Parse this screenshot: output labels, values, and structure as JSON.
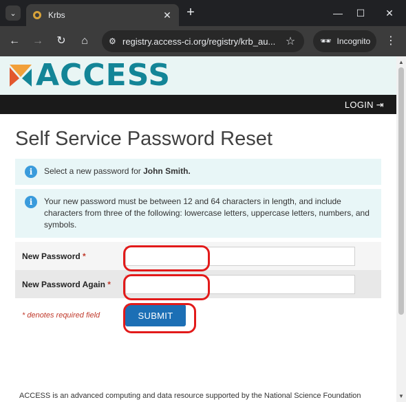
{
  "browser": {
    "tab_title": "Krbs",
    "url": "registry.access-ci.org/registry/krb_au...",
    "incognito_label": "Incognito"
  },
  "header": {
    "logo_text": "ACCESS",
    "login_label": "LOGIN"
  },
  "main": {
    "page_title": "Self Service Password Reset",
    "notice_1_prefix": "Select a new password for",
    "notice_1_user": "John Smith.",
    "notice_2": "Your new password must be between 12 and 64 characters in length, and include characters from three of the following: lowercase letters, uppercase letters, numbers, and symbols.",
    "fields": [
      {
        "label": "New Password",
        "required_mark": "*",
        "value": ""
      },
      {
        "label": "New Password Again",
        "required_mark": "*",
        "value": ""
      }
    ],
    "required_note": "* denotes required field",
    "submit_label": "SUBMIT"
  },
  "footer": {
    "text": "ACCESS is an advanced computing and data resource supported by the National Science Foundation"
  },
  "colors": {
    "brand_teal": "#138597",
    "submit_blue": "#1c6fb5",
    "highlight_red": "#e21a1a"
  }
}
